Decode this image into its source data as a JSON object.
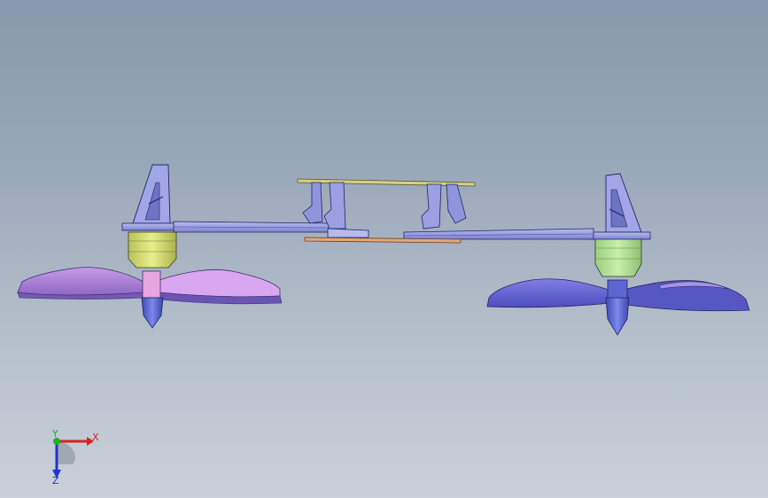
{
  "viewport": {
    "background_top": "#8799ac",
    "background_bottom": "#c9d0d9"
  },
  "model": {
    "arm_color": "#8f96dc",
    "deck_color": "#d7cf8a",
    "motor_left_color": "#d8e07a",
    "motor_right_color": "#b6e39a",
    "prop_left_color": "#b184d8",
    "prop_right_color": "#6f6fd8",
    "hub_color": "#5a67d8",
    "shaft_color": "#e9a3e0"
  },
  "triad": {
    "x_label": "X",
    "y_label": "Y",
    "z_label": "Z",
    "x_color": "#d62222",
    "y_color": "#22b022",
    "z_color": "#2233cc"
  }
}
